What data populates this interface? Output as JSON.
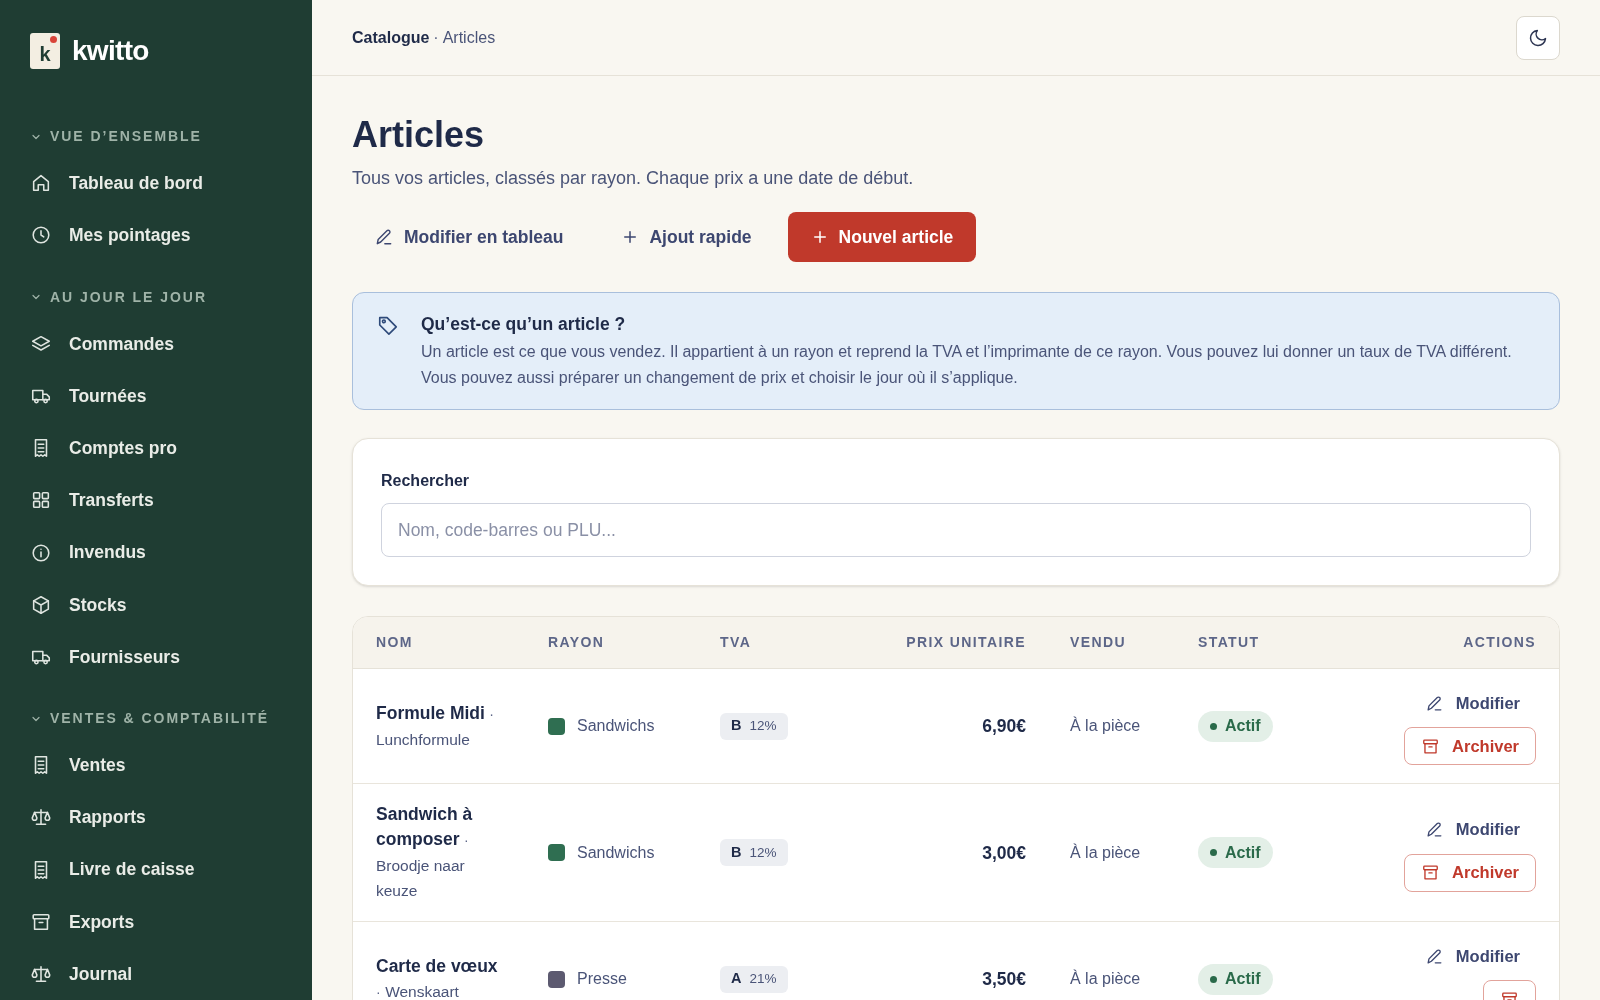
{
  "brand": {
    "logo_letter": "k",
    "name": "kwitto"
  },
  "sidebar": {
    "sections": [
      {
        "title": "VUE D’ENSEMBLE",
        "expanded": true,
        "items": [
          {
            "label": "Tableau de bord"
          },
          {
            "label": "Mes pointages"
          }
        ]
      },
      {
        "title": "AU JOUR LE JOUR",
        "expanded": true,
        "items": [
          {
            "label": "Commandes"
          },
          {
            "label": "Tournées"
          },
          {
            "label": "Comptes pro"
          },
          {
            "label": "Transferts"
          },
          {
            "label": "Invendus"
          },
          {
            "label": "Stocks"
          },
          {
            "label": "Fournisseurs"
          }
        ]
      },
      {
        "title": "VENTES & COMPTABILITÉ",
        "expanded": true,
        "items": [
          {
            "label": "Ventes"
          },
          {
            "label": "Rapports"
          },
          {
            "label": "Livre de caisse"
          },
          {
            "label": "Exports"
          },
          {
            "label": "Journal"
          }
        ]
      }
    ]
  },
  "breadcrumb": {
    "parent": "Catalogue",
    "separator": "·",
    "current": "Articles"
  },
  "page": {
    "title": "Articles",
    "subtitle": "Tous vos articles, classés par rayon. Chaque prix a une date de début."
  },
  "actions": [
    {
      "kind": "ghost",
      "label": "Modifier en tableau"
    },
    {
      "kind": "ghost-plus",
      "label": "Ajout rapide"
    },
    {
      "kind": "primary",
      "label": "Nouvel article"
    }
  ],
  "info": {
    "title": "Qu’est-ce qu’un article ?",
    "text": "Un article est ce que vous vendez. Il appartient à un rayon et reprend la TVA et l’imprimante de ce rayon. Vous pouvez lui donner un taux de TVA différent. Vous pouvez aussi préparer un changement de prix et choisir le jour où il s’applique."
  },
  "search": {
    "label": "Rechercher",
    "placeholder": "Nom, code-barres ou PLU..."
  },
  "table": {
    "columns": [
      "NOM",
      "RAYON",
      "TVA",
      "PRIX UNITAIRE",
      "VENDU",
      "STATUT",
      "ACTIONS"
    ],
    "name_separator": "·",
    "rows": [
      {
        "name": "Formule Midi",
        "alt": "Lunchformule",
        "rayon": "Sandwichs",
        "color": "#2f6e51",
        "tva_code": "B",
        "tva_rate": "12%",
        "price": "6,90€",
        "sold": "À la pièce",
        "status": "Actif",
        "edit": "Modifier",
        "archive": "Archiver"
      },
      {
        "name": "Sandwich à composer",
        "alt": "Broodje naar keuze",
        "rayon": "Sandwichs",
        "color": "#2f6e51",
        "tva_code": "B",
        "tva_rate": "12%",
        "price": "3,00€",
        "sold": "À la pièce",
        "status": "Actif",
        "edit": "Modifier",
        "archive": "Archiver"
      },
      {
        "name": "Carte de vœux",
        "alt": "Wenskaart",
        "rayon": "Presse",
        "color": "#5c5a70",
        "tva_code": "A",
        "tva_rate": "21%",
        "price": "3,50€",
        "sold": "À la pièce",
        "status": "Actif",
        "edit": "Modifier"
      }
    ]
  }
}
